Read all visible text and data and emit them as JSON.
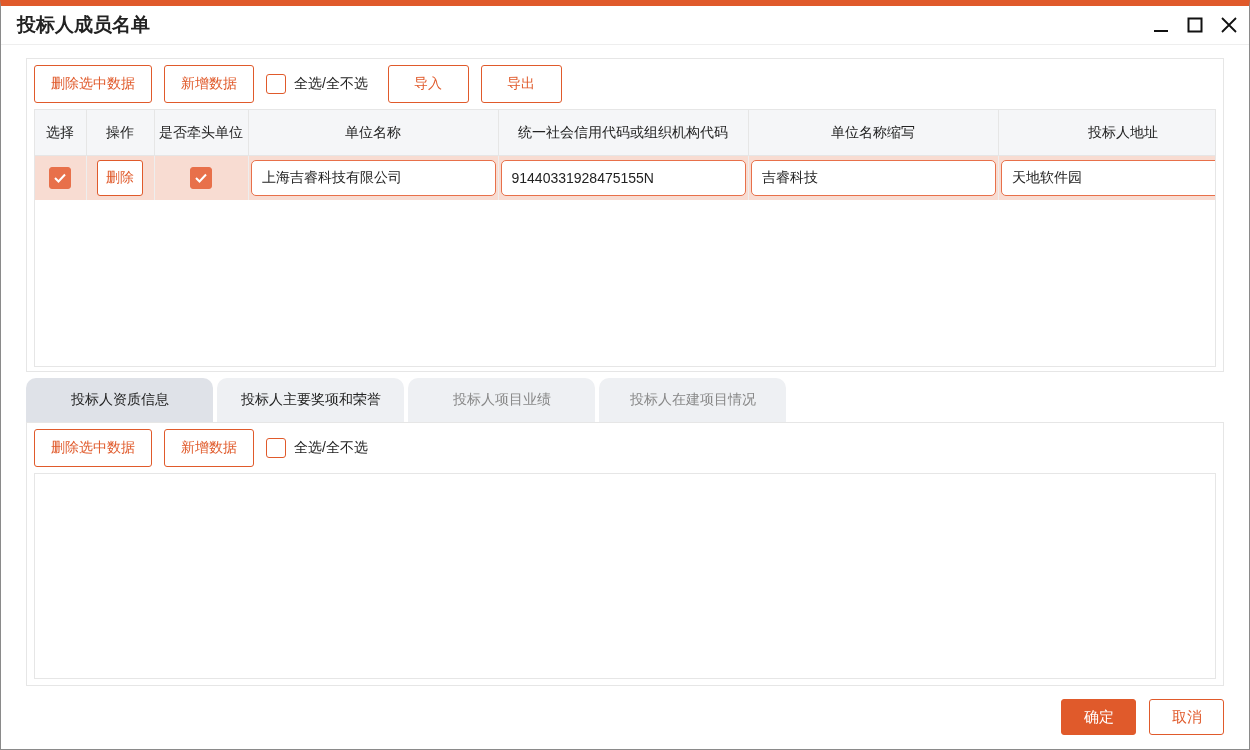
{
  "window": {
    "title": "投标人成员名单"
  },
  "members": {
    "toolbar": [
      {
        "kind": "button",
        "label": "删除选中数据"
      },
      {
        "kind": "button",
        "label": "新增数据"
      },
      {
        "kind": "checkbox",
        "label": "全选/全不选",
        "checked": false
      },
      {
        "kind": "button",
        "label": "导入"
      },
      {
        "kind": "button",
        "label": "导出"
      }
    ],
    "table": {
      "columns": [
        "选择",
        "操作",
        "是否牵头单位",
        "单位名称",
        "统一社会信用代码或组织机构代码",
        "单位名称缩写",
        "投标人地址"
      ],
      "rows": [
        {
          "checked": true,
          "action": "删除",
          "lead_unit": true,
          "name": "上海吉睿科技有限公司",
          "credit_code": "91440331928475155N",
          "short_name": "吉睿科技",
          "address": "天地软件园"
        }
      ]
    }
  },
  "tabs": [
    {
      "label": "投标人资质信息",
      "selected": true,
      "disabled": false
    },
    {
      "label": "投标人主要奖项和荣誉",
      "selected": false,
      "disabled": false
    },
    {
      "label": "投标人项目业绩",
      "selected": false,
      "disabled": true
    },
    {
      "label": "投标人在建项目情况",
      "selected": false,
      "disabled": true
    }
  ],
  "qualification": {
    "toolbar": [
      {
        "kind": "button",
        "label": "删除选中数据"
      },
      {
        "kind": "button",
        "label": "新增数据"
      },
      {
        "kind": "checkbox",
        "label": "全选/全不选",
        "checked": false
      }
    ]
  },
  "footer": {
    "buttons": [
      {
        "kind": "primary",
        "label": "确定"
      },
      {
        "kind": "secondary",
        "label": "取消"
      }
    ]
  }
}
